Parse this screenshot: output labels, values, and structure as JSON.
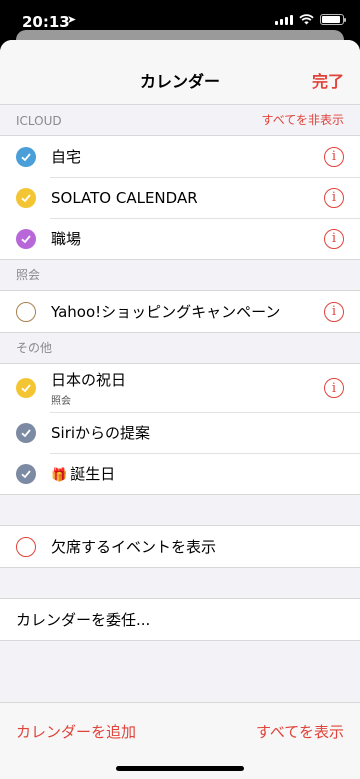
{
  "status_bar": {
    "time": "20:13",
    "location_arrow": "location-arrow-icon"
  },
  "nav": {
    "title": "カレンダー",
    "done": "完了"
  },
  "sections": {
    "icloud": {
      "header": "ICLOUD",
      "action": "すべてを非表示",
      "items": [
        {
          "label": "自宅",
          "color": "#4a9fd8"
        },
        {
          "label": "SOLATO CALENDAR",
          "color": "#f4c533"
        },
        {
          "label": "職場",
          "color": "#b867d9"
        }
      ]
    },
    "shared": {
      "header": "照会",
      "items": [
        {
          "label": "Yahoo!ショッピングキャンペーン",
          "color": "#a8804e",
          "checked": false
        }
      ]
    },
    "other": {
      "header": "その他",
      "items": [
        {
          "label": "日本の祝日",
          "sub": "照会",
          "color": "#f4c533"
        },
        {
          "label": "Siriからの提案",
          "color": "#7c8aa3"
        },
        {
          "label": "誕生日",
          "color": "#7c8aa3",
          "icon": "gift-icon"
        }
      ]
    }
  },
  "declined_events": {
    "label": "欠席するイベントを表示",
    "checked": false,
    "color": "#e0433a"
  },
  "delegate": {
    "label": "カレンダーを委任..."
  },
  "bottom_bar": {
    "add": "カレンダーを追加",
    "show_all": "すべてを表示"
  },
  "colors": {
    "accent": "#e0433a"
  }
}
